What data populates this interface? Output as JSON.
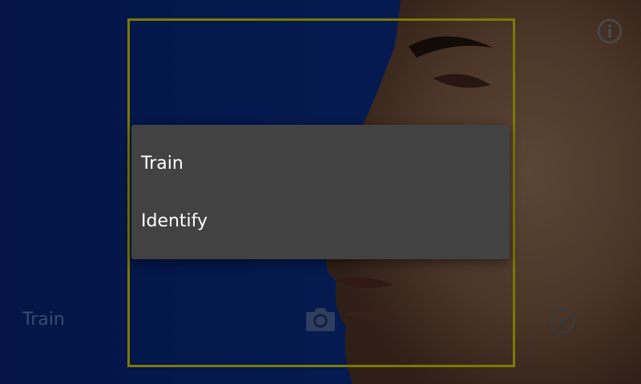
{
  "preview": {
    "background_color": "#0b36a8",
    "detection_box_color": "#7c7a00"
  },
  "controls": {
    "mode_label": "Train",
    "camera_icon": "camera-icon",
    "dropdown_icon": "chevron-down-circle-icon",
    "info_icon": "info-icon"
  },
  "menu": {
    "background_color": "#424242",
    "items": [
      {
        "label": "Train"
      },
      {
        "label": "Identify"
      }
    ]
  }
}
